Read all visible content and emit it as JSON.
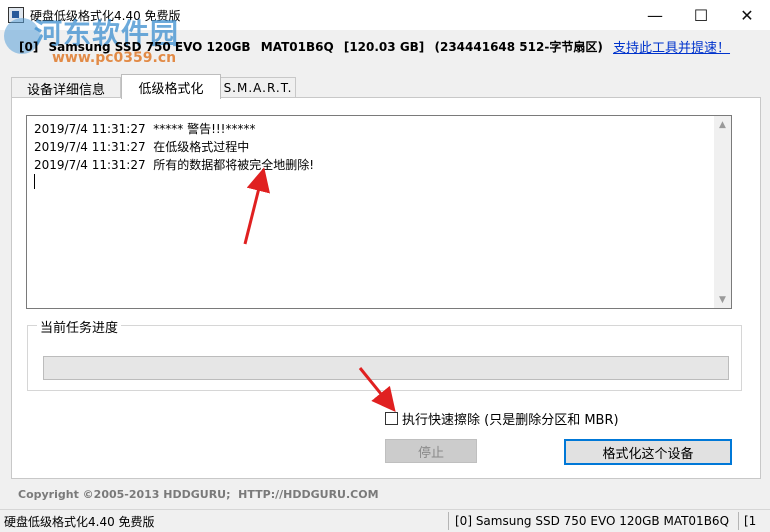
{
  "window": {
    "title": "硬盘低级格式化4.40  免费版",
    "minimize_glyph": "—",
    "maximize_glyph": "☐",
    "close_glyph": "✕"
  },
  "watermark": {
    "site_name": "河东软件园",
    "site_url": "www.pc0359.cn"
  },
  "device": {
    "index": "[0]",
    "model": "Samsung SSD 750 EVO 120GB",
    "serial": "MAT01B6Q",
    "capacity": "[120.03 GB]",
    "sectors": "(234441648 512-字节扇区)"
  },
  "support_link": "支持此工具并提速！",
  "tabs": [
    {
      "label": "设备详细信息",
      "active": false
    },
    {
      "label": "低级格式化",
      "active": true
    },
    {
      "label": "S.M.A.R.T.",
      "active": false
    }
  ],
  "log": [
    {
      "time": "2019/7/4 11:31:27",
      "message": "***** 警告!!!*****"
    },
    {
      "time": "2019/7/4 11:31:27",
      "message": "在低级格式过程中"
    },
    {
      "time": "2019/7/4 11:31:27",
      "message": "所有的数据都将被完全地删除!"
    }
  ],
  "progress": {
    "label": "当前任务进度",
    "fraction": 0
  },
  "quick_wipe": {
    "label": "执行快速擦除 (只是删除分区和 MBR)",
    "checked": false
  },
  "buttons": {
    "stop": "停止",
    "format": "格式化这个设备"
  },
  "copyright": "Copyright ©2005-2013 HDDGURU;  HTTP://HDDGURU.COM",
  "statusbar": {
    "app": "硬盘低级格式化4.40  免费版",
    "device": "[0]  Samsung SSD 750 EVO 120GB    MAT01B6Q",
    "overflow": "[1"
  },
  "colors": {
    "accent": "#0078d7",
    "link": "#0033cc",
    "arrow": "#e02020"
  }
}
